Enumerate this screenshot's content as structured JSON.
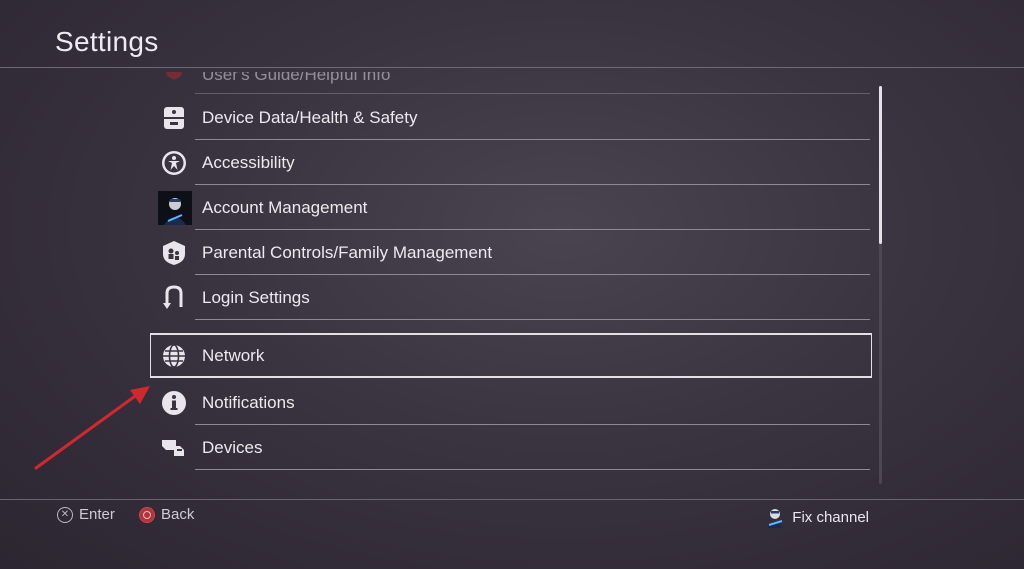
{
  "header": {
    "title": "Settings"
  },
  "menu": {
    "items": [
      {
        "label": "User's Guide/Helpful Info",
        "icon": "guide-icon"
      },
      {
        "label": "Device Data/Health & Safety",
        "icon": "device-data-icon"
      },
      {
        "label": "Accessibility",
        "icon": "accessibility-icon"
      },
      {
        "label": "Account Management",
        "icon": "avatar-icon"
      },
      {
        "label": "Parental Controls/Family Management",
        "icon": "parental-controls-icon"
      },
      {
        "label": "Login Settings",
        "icon": "login-icon"
      },
      {
        "label": "Network",
        "icon": "network-globe-icon",
        "selected": true
      },
      {
        "label": "Notifications",
        "icon": "info-icon"
      },
      {
        "label": "Devices",
        "icon": "devices-icon"
      }
    ]
  },
  "footer": {
    "enter_label": "Enter",
    "back_label": "Back",
    "fix_channel_label": "Fix channel"
  },
  "colors": {
    "background": "#3a3340",
    "selection_border": "#e2dfe6",
    "annotation_arrow": "#d1282e",
    "back_button": "#b3343a"
  }
}
